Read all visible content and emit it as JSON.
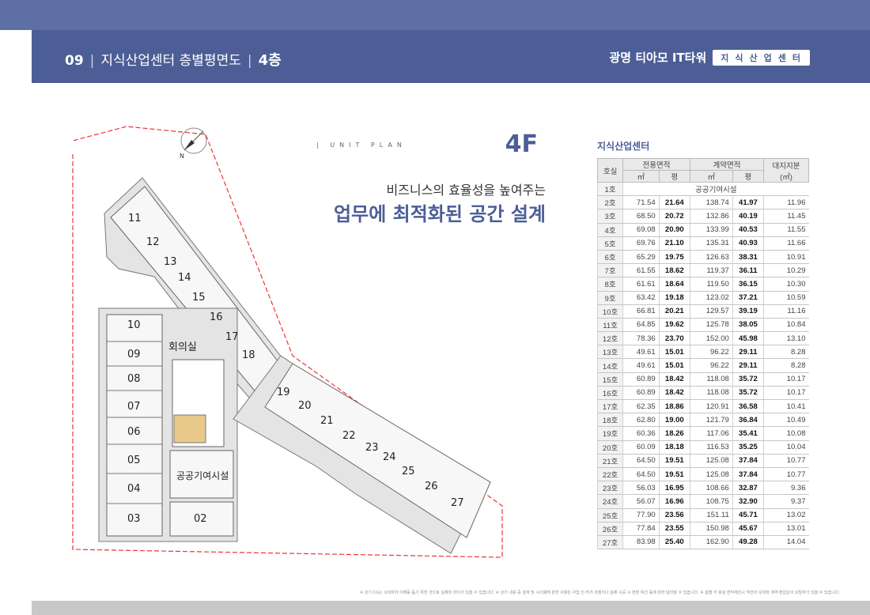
{
  "header": {
    "section_num": "09",
    "section_title": "지식산업센터 층별평면도",
    "floor": "4층",
    "brand": "광명 티아모 IT타워",
    "badge": "지식산업센터"
  },
  "title_block": {
    "unit_plan": "UNIT PLAN",
    "floor_code": "4F",
    "subtitle": "비즈니스의 효율성을 높여주는",
    "headline": "업무에 최적화된 공간 설계"
  },
  "plan": {
    "units": [
      "11",
      "12",
      "13",
      "14",
      "15",
      "16",
      "17",
      "18",
      "19",
      "20",
      "21",
      "22",
      "23",
      "24",
      "25",
      "26",
      "27",
      "10",
      "09",
      "08",
      "07",
      "06",
      "05",
      "04",
      "03",
      "02"
    ],
    "meeting_room": "회의실",
    "public_facility": "공공기여시설"
  },
  "table": {
    "title": "지식산업센터",
    "headers": {
      "unit": "호실",
      "exclusive": "전용면적",
      "contract": "계약면적",
      "land": "대지지분",
      "land_unit": "(㎡)",
      "sqm": "㎡",
      "pyeong": "평"
    },
    "row1": {
      "unit": "1호",
      "note": "공공기여시설"
    },
    "rows": [
      [
        "2호",
        "71.54",
        "21.64",
        "138.74",
        "41.97",
        "11.96"
      ],
      [
        "3호",
        "68.50",
        "20.72",
        "132.86",
        "40.19",
        "11.45"
      ],
      [
        "4호",
        "69.08",
        "20.90",
        "133.99",
        "40.53",
        "11.55"
      ],
      [
        "5호",
        "69.76",
        "21.10",
        "135.31",
        "40.93",
        "11.66"
      ],
      [
        "6호",
        "65.29",
        "19.75",
        "126.63",
        "38.31",
        "10.91"
      ],
      [
        "7호",
        "61.55",
        "18.62",
        "119.37",
        "36.11",
        "10.29"
      ],
      [
        "8호",
        "61.61",
        "18.64",
        "119.50",
        "36.15",
        "10.30"
      ],
      [
        "9호",
        "63.42",
        "19.18",
        "123.02",
        "37.21",
        "10.59"
      ],
      [
        "10호",
        "66.81",
        "20.21",
        "129.57",
        "39.19",
        "11.16"
      ],
      [
        "11호",
        "64.85",
        "19.62",
        "125.78",
        "38.05",
        "10.84"
      ],
      [
        "12호",
        "78.36",
        "23.70",
        "152.00",
        "45.98",
        "13.10"
      ],
      [
        "13호",
        "49.61",
        "15.01",
        "96.22",
        "29.11",
        "8.28"
      ],
      [
        "14호",
        "49.61",
        "15.01",
        "96.22",
        "29.11",
        "8.28"
      ],
      [
        "15호",
        "60.89",
        "18.42",
        "118.08",
        "35.72",
        "10.17"
      ],
      [
        "16호",
        "60.89",
        "18.42",
        "118.08",
        "35.72",
        "10.17"
      ],
      [
        "17호",
        "62.35",
        "18.86",
        "120.91",
        "36.58",
        "10.41"
      ],
      [
        "18호",
        "62.80",
        "19.00",
        "121.79",
        "36.84",
        "10.49"
      ],
      [
        "19호",
        "60.36",
        "18.26",
        "117.06",
        "35.41",
        "10.08"
      ],
      [
        "20호",
        "60.09",
        "18.18",
        "116.53",
        "35.25",
        "10.04"
      ],
      [
        "21호",
        "64.50",
        "19.51",
        "125.08",
        "37.84",
        "10.77"
      ],
      [
        "22호",
        "64.50",
        "19.51",
        "125.08",
        "37.84",
        "10.77"
      ],
      [
        "23호",
        "56.03",
        "16.95",
        "108.66",
        "32.87",
        "9.36"
      ],
      [
        "24호",
        "56.07",
        "16.96",
        "108.75",
        "32.90",
        "9.37"
      ],
      [
        "25호",
        "77.90",
        "23.56",
        "151.11",
        "45.71",
        "13.02"
      ],
      [
        "26호",
        "77.84",
        "23.55",
        "150.98",
        "45.67",
        "13.01"
      ],
      [
        "27호",
        "83.98",
        "25.40",
        "162.90",
        "49.28",
        "14.04"
      ]
    ]
  },
  "footnote": "※ 상기 CG는 소비자의 이해를 돕기 위한 것으로 실제와 차이가 있을 수 있습니다. ※ 상기 내용 중 설계 및 시스템에 관한 사항은 사업 인·허가 과정이나 실제 시공 시 현장 여건 등에 따라 달라질 수 있습니다. ※ 층별 각 호실 면적계산시 약간의 오차와 계약·편집상의 오탈자가 있을 수 있습니다."
}
